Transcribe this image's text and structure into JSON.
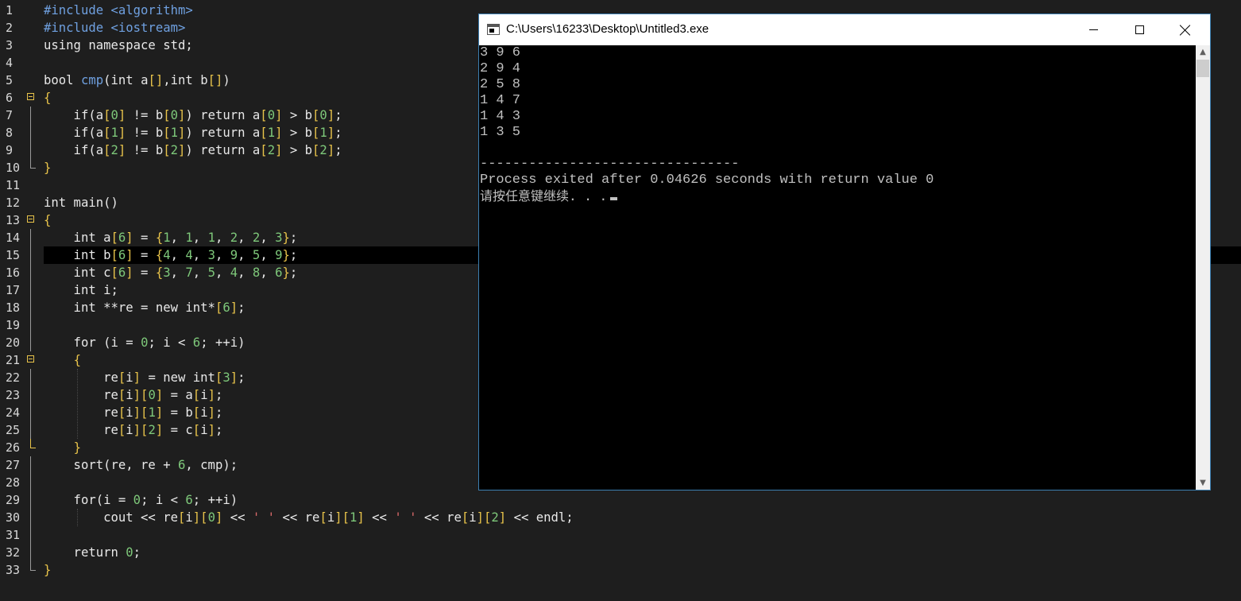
{
  "editor": {
    "line_numbers": [
      "1",
      "2",
      "3",
      "4",
      "5",
      "6",
      "7",
      "8",
      "9",
      "10",
      "11",
      "12",
      "13",
      "14",
      "15",
      "16",
      "17",
      "18",
      "19",
      "20",
      "21",
      "22",
      "23",
      "24",
      "25",
      "26",
      "27",
      "28",
      "29",
      "30",
      "31",
      "32",
      "33"
    ],
    "current_line": 15
  },
  "console_window": {
    "title": "C:\\Users\\16233\\Desktop\\Untitled3.exe",
    "output_lines": [
      "3 9 6",
      "2 9 4",
      "2 5 8",
      "1 4 7",
      "1 4 3",
      "1 3 5",
      "",
      "--------------------------------",
      "Process exited after 0.04626 seconds with return value 0"
    ],
    "prompt_text": "请按任意键继续. . .",
    "scroll_up_glyph": "▲",
    "scroll_down_glyph": "▼"
  },
  "colors": {
    "editor_bg": "#1e1e1e",
    "keyword_blue": "#6fa0e0",
    "number_green": "#7ec87a",
    "brace_yellow": "#e8c34a",
    "string_red": "#e06c6c",
    "console_bg": "#000000",
    "console_text": "#c0c0c0",
    "window_border": "#3c7fb1"
  },
  "icons": [
    "app-console-icon",
    "minimize-icon",
    "maximize-icon",
    "close-icon",
    "fold-icon"
  ]
}
